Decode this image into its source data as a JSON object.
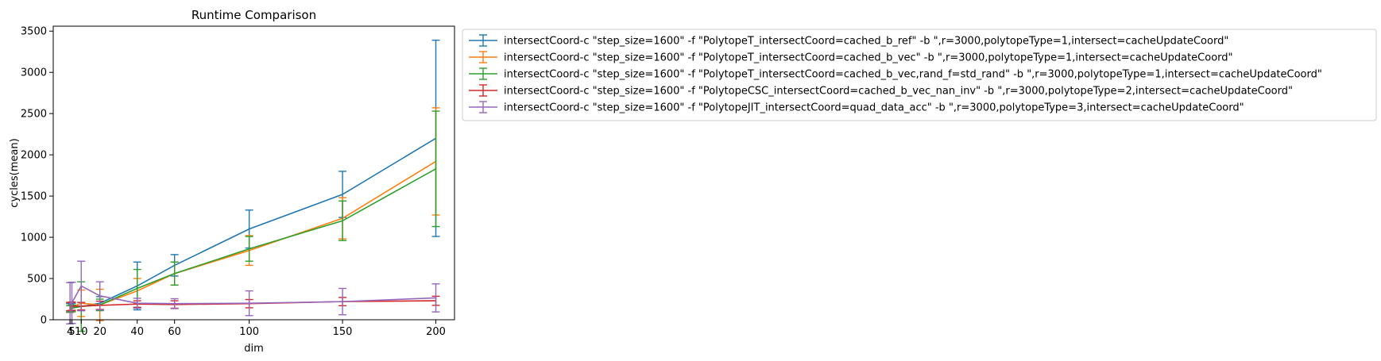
{
  "chart_data": {
    "type": "line",
    "title": "Runtime Comparison",
    "xlabel": "dim",
    "ylabel": "cycles(mean)",
    "x": [
      4,
      5,
      10,
      20,
      40,
      60,
      100,
      150,
      200
    ],
    "xticks": [
      4,
      5,
      10,
      20,
      40,
      60,
      100,
      150,
      200
    ],
    "yticks": [
      0,
      500,
      1000,
      1500,
      2000,
      2500,
      3000,
      3500
    ],
    "xlim": [
      -5,
      210
    ],
    "ylim": [
      0,
      3560
    ],
    "grid": false,
    "legend_position": "outside-top-right",
    "error_bars": true,
    "series": [
      {
        "name": "intersectCoord-c \"step_size=1600\" -f \"PolytopeT_intersectCoord=cached_b_ref\" -b \",r=3000,polytopeType=1,intersect=cacheUpdateCoord\"",
        "color": "#1f77b4",
        "values": [
          150,
          155,
          160,
          200,
          410,
          660,
          1100,
          1520,
          2200
        ],
        "errors": [
          45,
          45,
          50,
          80,
          290,
          130,
          230,
          280,
          1190
        ]
      },
      {
        "name": "intersectCoord-c \"step_size=1600\" -f \"PolytopeT_intersectCoord=cached_b_vec\" -b \",r=3000,polytopeType=1,intersect=cacheUpdateCoord\"",
        "color": "#ff7f0e",
        "values": [
          150,
          155,
          200,
          180,
          350,
          560,
          840,
          1230,
          1920
        ],
        "errors": [
          60,
          60,
          160,
          190,
          150,
          140,
          180,
          250,
          650
        ]
      },
      {
        "name": "intersectCoord-c \"step_size=1600\" -f \"PolytopeT_intersectCoord=cached_b_vec,rand_f=std_rand\" -b \",r=3000,polytopeType=1,intersect=cacheUpdateCoord\"",
        "color": "#2ca02c",
        "values": [
          130,
          140,
          160,
          180,
          380,
          560,
          860,
          1200,
          1830
        ],
        "errors": [
          40,
          40,
          300,
          70,
          230,
          140,
          150,
          240,
          700
        ]
      },
      {
        "name": "intersectCoord-c \"step_size=1600\" -f \"PolytopeCSC_intersectCoord=cached_b_vec_nan_inv\" -b \",r=3000,polytopeType=2,intersect=cacheUpdateCoord\"",
        "color": "#d62728",
        "values": [
          160,
          165,
          165,
          175,
          190,
          185,
          195,
          220,
          230
        ],
        "errors": [
          50,
          50,
          45,
          50,
          40,
          45,
          50,
          50,
          55
        ]
      },
      {
        "name": "intersectCoord-c \"step_size=1600\" -f \"PolytopeJIT_intersectCoord=quad_data_acc\" -b \",r=3000,polytopeType=3,intersect=cacheUpdateCoord\"",
        "color": "#9467bd",
        "values": [
          200,
          205,
          410,
          290,
          200,
          195,
          200,
          220,
          265
        ],
        "errors": [
          250,
          250,
          300,
          170,
          60,
          60,
          150,
          160,
          170
        ]
      }
    ]
  }
}
